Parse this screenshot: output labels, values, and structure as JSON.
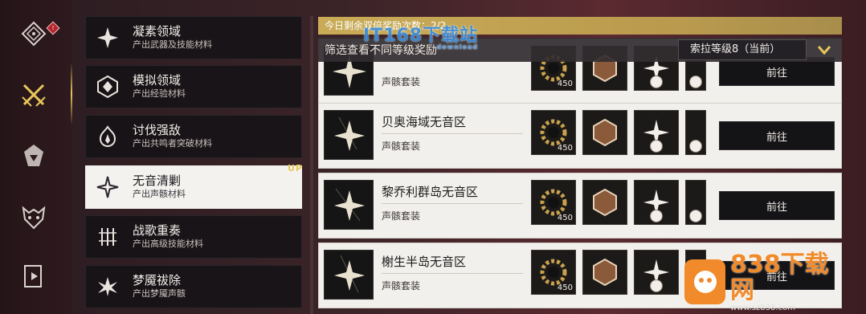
{
  "rail": {
    "items": [
      {
        "icon": "diamond-compass-icon"
      },
      {
        "icon": "crossed-swords-icon"
      },
      {
        "icon": "echo-fragment-icon"
      },
      {
        "icon": "beast-mask-icon"
      },
      {
        "icon": "bookmark-tab-icon"
      }
    ],
    "badge": "!"
  },
  "menu": {
    "items": [
      {
        "title": "凝素领域",
        "sub": "产出武器及技能材料"
      },
      {
        "title": "模拟领域",
        "sub": "产出经验材料"
      },
      {
        "title": "讨伐强敌",
        "sub": "产出共鸣者突破材料"
      },
      {
        "title": "无音清剿",
        "sub": "产出声骸材料",
        "tag": "UP"
      },
      {
        "title": "战歌重奏",
        "sub": "产出高级技能材料"
      },
      {
        "title": "梦魇祓除",
        "sub": "产出梦魇声骸"
      }
    ]
  },
  "banner": {
    "text": "今日剩余双倍奖励次数：2/2"
  },
  "filter": {
    "label": "筛选查看不同等级奖励",
    "selected": "索拉等级8（当前）"
  },
  "rows": [
    {
      "title": "",
      "sub": "声骸套装",
      "qty": "450",
      "button": "前往"
    },
    {
      "title": "贝奥海域无音区",
      "sub": "声骸套装",
      "qty": "450",
      "button": "前往"
    },
    {
      "title": "黎乔利群岛无音区",
      "sub": "声骸套装",
      "qty": "450",
      "button": "前往"
    },
    {
      "title": "榭生半岛无音区",
      "sub": "声骸套装",
      "qty": "450",
      "button": "前往"
    }
  ],
  "watermark": {
    "top": "IT168下载站",
    "top_sub": "download",
    "brand": "838下载网",
    "url": "www.sz838.com"
  },
  "colors": {
    "accent": "#e8c75a",
    "banner": "#c9ab57",
    "row_bg": "#f2f0ec",
    "button_bg": "#141316"
  }
}
